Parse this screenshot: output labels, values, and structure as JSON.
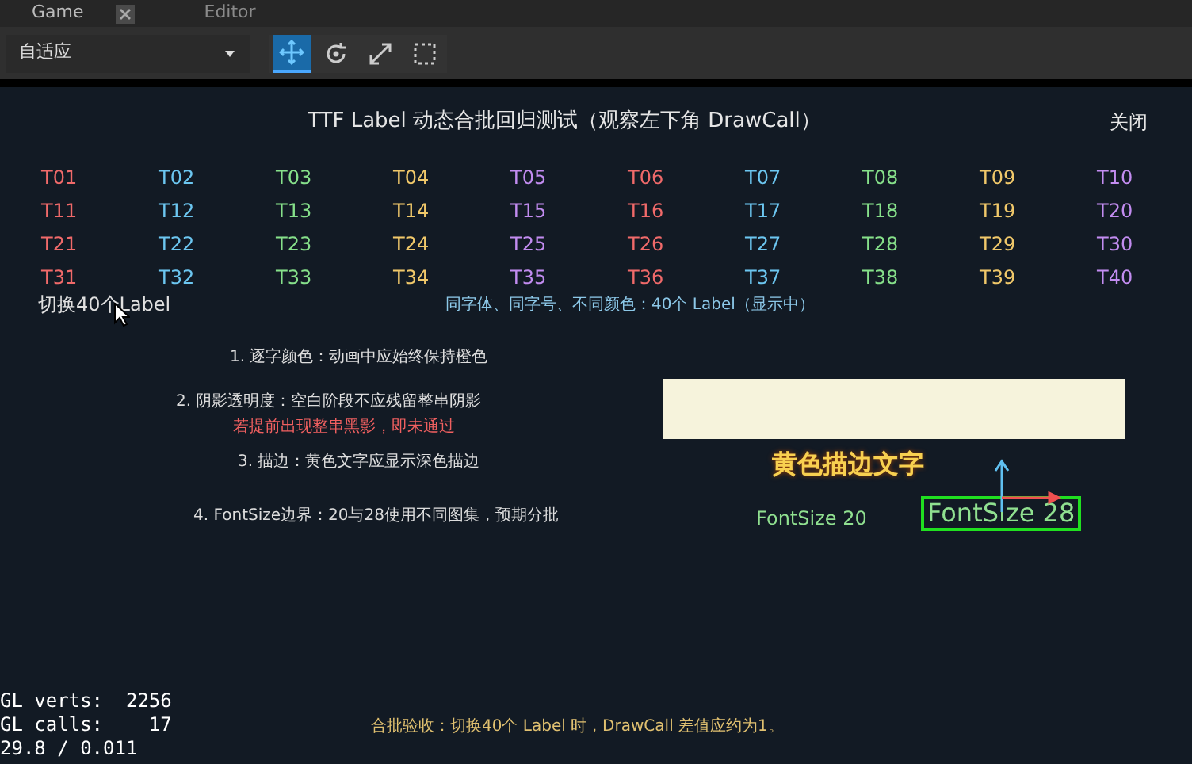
{
  "tabs": [
    {
      "label": "Game",
      "selected": true
    },
    {
      "label": "Editor",
      "selected": false
    }
  ],
  "toolbar": {
    "resolution": "自适应",
    "tools": [
      {
        "kind": "move",
        "selected": true
      },
      {
        "kind": "rotate",
        "selected": false
      },
      {
        "kind": "scale",
        "selected": false
      },
      {
        "kind": "rect",
        "selected": false
      }
    ]
  },
  "scene": {
    "title": "TTF Label 动态合批回归测试（观察左下角 DrawCall）",
    "close": "关闭",
    "labels": [
      {
        "text": "T01",
        "color": "#f06a6a"
      },
      {
        "text": "T02",
        "color": "#6cc6f0"
      },
      {
        "text": "T03",
        "color": "#86e08a"
      },
      {
        "text": "T04",
        "color": "#f0c86a"
      },
      {
        "text": "T05",
        "color": "#c28cf0"
      },
      {
        "text": "T06",
        "color": "#f06a6a"
      },
      {
        "text": "T07",
        "color": "#6cc6f0"
      },
      {
        "text": "T08",
        "color": "#86e08a"
      },
      {
        "text": "T09",
        "color": "#f0c86a"
      },
      {
        "text": "T10",
        "color": "#c28cf0"
      },
      {
        "text": "T11",
        "color": "#f06a6a"
      },
      {
        "text": "T12",
        "color": "#6cc6f0"
      },
      {
        "text": "T13",
        "color": "#86e08a"
      },
      {
        "text": "T14",
        "color": "#f0c86a"
      },
      {
        "text": "T15",
        "color": "#c28cf0"
      },
      {
        "text": "T16",
        "color": "#f06a6a"
      },
      {
        "text": "T17",
        "color": "#6cc6f0"
      },
      {
        "text": "T18",
        "color": "#86e08a"
      },
      {
        "text": "T19",
        "color": "#f0c86a"
      },
      {
        "text": "T20",
        "color": "#c28cf0"
      },
      {
        "text": "T21",
        "color": "#f06a6a"
      },
      {
        "text": "T22",
        "color": "#6cc6f0"
      },
      {
        "text": "T23",
        "color": "#86e08a"
      },
      {
        "text": "T24",
        "color": "#f0c86a"
      },
      {
        "text": "T25",
        "color": "#c28cf0"
      },
      {
        "text": "T26",
        "color": "#f06a6a"
      },
      {
        "text": "T27",
        "color": "#6cc6f0"
      },
      {
        "text": "T28",
        "color": "#86e08a"
      },
      {
        "text": "T29",
        "color": "#f0c86a"
      },
      {
        "text": "T30",
        "color": "#c28cf0"
      },
      {
        "text": "T31",
        "color": "#f06a6a"
      },
      {
        "text": "T32",
        "color": "#6cc6f0"
      },
      {
        "text": "T33",
        "color": "#86e08a"
      },
      {
        "text": "T34",
        "color": "#f0c86a"
      },
      {
        "text": "T35",
        "color": "#c28cf0"
      },
      {
        "text": "T36",
        "color": "#f06a6a"
      },
      {
        "text": "T37",
        "color": "#6cc6f0"
      },
      {
        "text": "T38",
        "color": "#86e08a"
      },
      {
        "text": "T39",
        "color": "#f0c86a"
      },
      {
        "text": "T40",
        "color": "#c28cf0"
      }
    ],
    "toggle": "切换40个Label",
    "status": "同字体、同字号、不同颜色：40个 Label（显示中）",
    "check1": "1. 逐字颜色：动画中应始终保持橙色",
    "check2": "2. 阴影透明度：空白阶段不应残留整串阴影",
    "check2_warning": "若提前出现整串黑影，即未通过",
    "check3": "3. 描边：黄色文字应显示深色描边",
    "outline_text": "黄色描边文字",
    "check4": "4. FontSize边界：20与28使用不同图集，预期分批",
    "fs20": "FontSize 20",
    "fs28": "FontSize 28",
    "stats": [
      "GL verts:  2256",
      "GL calls:    17",
      "29.8 / 0.011"
    ],
    "footer": "合批验收：切换40个 Label 时，DrawCall 差值应约为1。"
  }
}
